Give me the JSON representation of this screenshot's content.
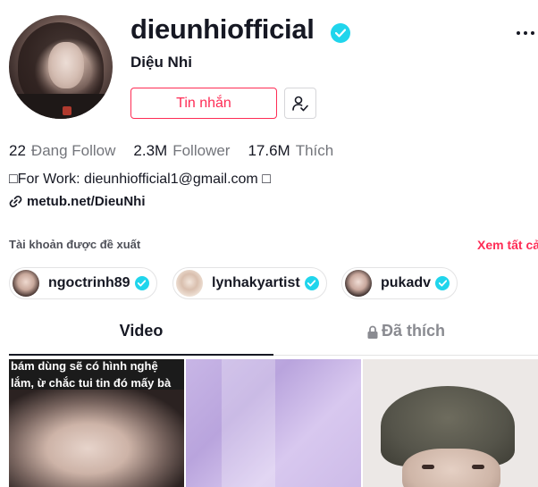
{
  "profile": {
    "username": "dieunhiofficial",
    "nickname": "Diệu Nhi",
    "message_label": "Tin nhắn"
  },
  "stats": [
    {
      "num": "22",
      "label": "Đang Follow"
    },
    {
      "num": "2.3M",
      "label": "Follower"
    },
    {
      "num": "17.6M",
      "label": "Thích"
    }
  ],
  "bio": "□For Work: dieunhiofficial1@gmail.com □",
  "link": "metub.net/DieuNhi",
  "suggested": {
    "title": "Tài khoản được đề xuất",
    "see_all": "Xem tất cả",
    "accounts": [
      {
        "name": "ngoctrinh89"
      },
      {
        "name": "lynhakyartist"
      },
      {
        "name": "pukadv"
      }
    ]
  },
  "tabs": {
    "video": "Video",
    "liked": "Đã thích"
  },
  "videos": [
    {
      "caption_line1": "bám dùng sẽ có hình nghệ",
      "caption_line2": "lắm, ừ chắc tui tin đó mấy bà"
    }
  ],
  "colors": {
    "brand": "#fe2c55",
    "verified": "#20d5ec"
  },
  "icons": [
    "verified-badge-icon",
    "more-options-icon",
    "follow-user-icon",
    "link-icon",
    "lock-icon"
  ]
}
